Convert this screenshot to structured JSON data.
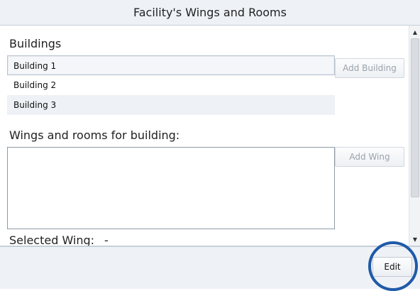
{
  "window": {
    "title": "Facility's Wings and Rooms"
  },
  "buildings": {
    "label": "Buildings",
    "items": [
      "Building 1",
      "Building 2",
      "Building 3"
    ],
    "selected_index": 0,
    "add_button": "Add Building"
  },
  "wings": {
    "label": "Wings and rooms for building:",
    "add_button": "Add Wing"
  },
  "selected_wing": {
    "label": "Selected Wing:",
    "value": "-"
  },
  "footer": {
    "edit_button": "Edit"
  },
  "colors": {
    "highlight_ring": "#1f5aa8",
    "header_bg": "#eef2f7"
  },
  "icons": {
    "scroll_up": "▲",
    "scroll_down": "▼"
  }
}
